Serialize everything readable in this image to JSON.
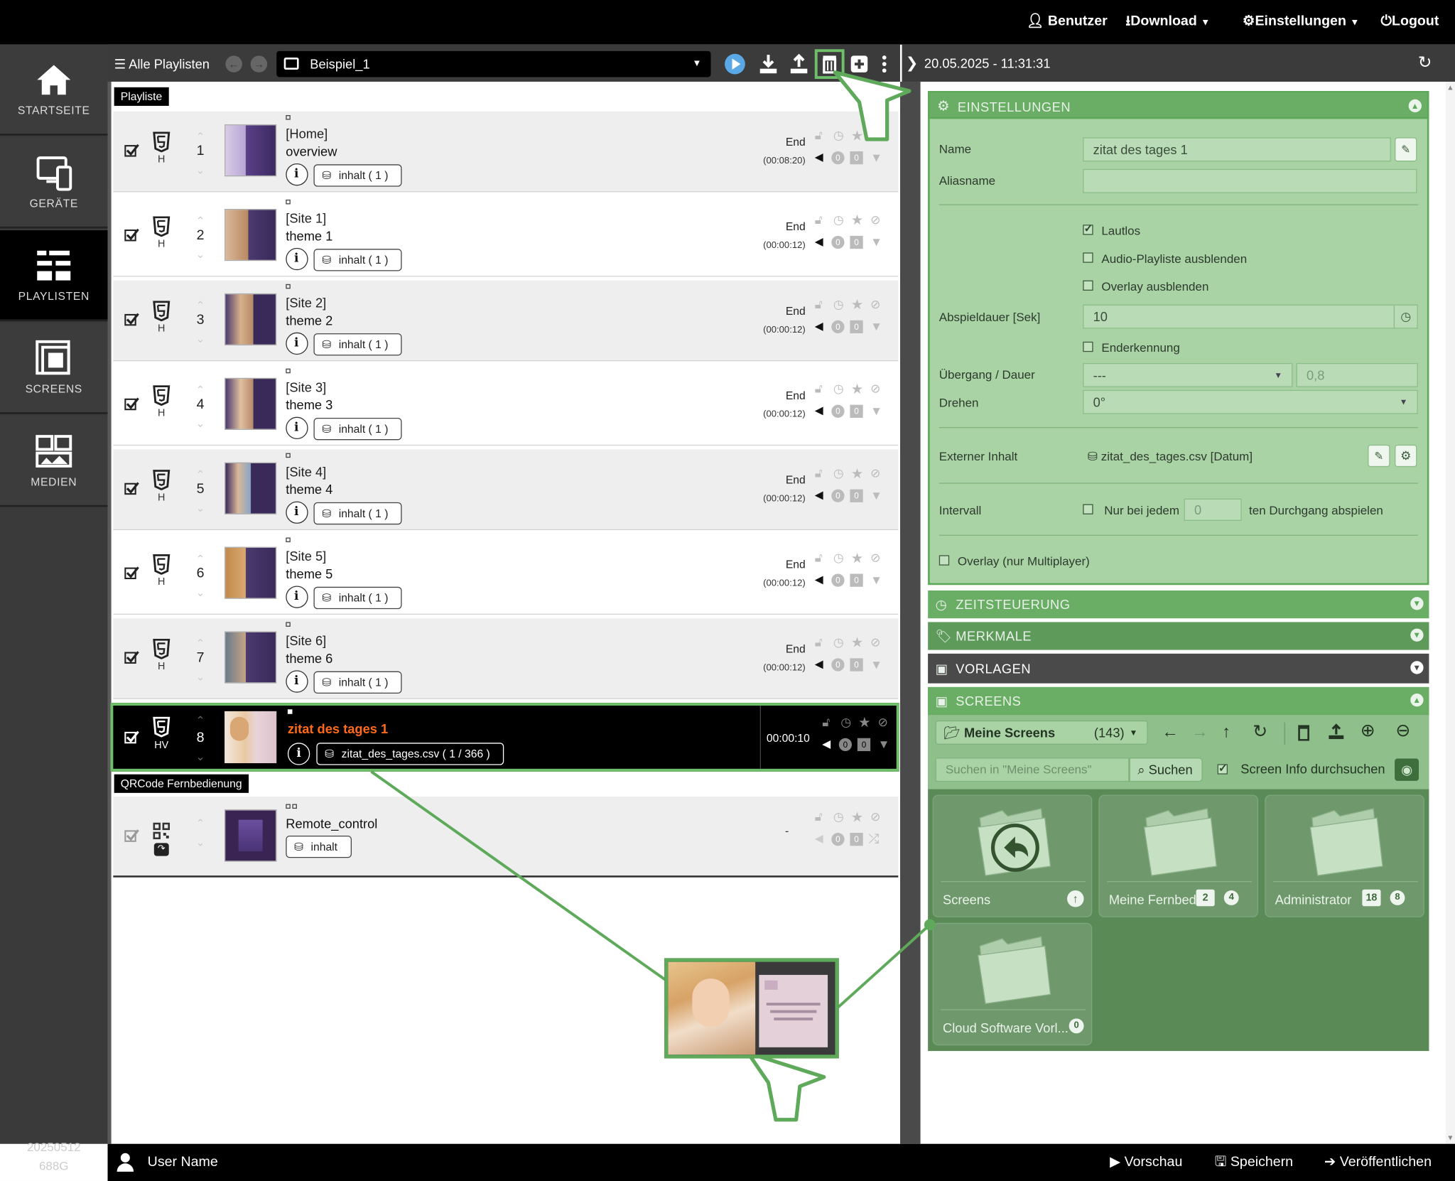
{
  "topbar": {
    "benutzer": "Benutzer",
    "download": "Download",
    "einstellungen": "Einstellungen",
    "logout": "Logout"
  },
  "sidebar": {
    "items": [
      {
        "label": "STARTSEITE",
        "icon": "home-icon"
      },
      {
        "label": "GERÄTE",
        "icon": "devices-icon"
      },
      {
        "label": "PLAYLISTEN",
        "icon": "playlist-icon"
      },
      {
        "label": "SCREENS",
        "icon": "screens-icon"
      },
      {
        "label": "MEDIEN",
        "icon": "media-icon"
      }
    ],
    "version_line1": "20250512",
    "version_line2": "688G"
  },
  "playlist_header": {
    "all_playlists": "Alle Playlisten",
    "selected": "Beispiel_1",
    "datetime": "20.05.2025 - 11:31:31"
  },
  "badges": {
    "playlist": "Playliste",
    "qrcode": "QRCode Fernbedienung"
  },
  "rows": [
    {
      "num": "1",
      "h": "H",
      "t1": "[Home]",
      "t2": "overview",
      "inhalt": "inhalt ( 1 )",
      "end": "End",
      "time": "(00:08:20)"
    },
    {
      "num": "2",
      "h": "H",
      "t1": "[Site 1]",
      "t2": "theme 1",
      "inhalt": "inhalt ( 1 )",
      "end": "End",
      "time": "(00:00:12)"
    },
    {
      "num": "3",
      "h": "H",
      "t1": "[Site 2]",
      "t2": "theme 2",
      "inhalt": "inhalt ( 1 )",
      "end": "End",
      "time": "(00:00:12)"
    },
    {
      "num": "4",
      "h": "H",
      "t1": "[Site 3]",
      "t2": "theme 3",
      "inhalt": "inhalt ( 1 )",
      "end": "End",
      "time": "(00:00:12)"
    },
    {
      "num": "5",
      "h": "H",
      "t1": "[Site 4]",
      "t2": "theme 4",
      "inhalt": "inhalt ( 1 )",
      "end": "End",
      "time": "(00:00:12)"
    },
    {
      "num": "6",
      "h": "H",
      "t1": "[Site 5]",
      "t2": "theme 5",
      "inhalt": "inhalt ( 1 )",
      "end": "End",
      "time": "(00:00:12)"
    },
    {
      "num": "7",
      "h": "H",
      "t1": "[Site 6]",
      "t2": "theme 6",
      "inhalt": "inhalt ( 1 )",
      "end": "End",
      "time": "(00:00:12)"
    }
  ],
  "selected_row": {
    "num": "8",
    "h": "HV",
    "title": "zitat des tages 1",
    "file": "zitat_des_tages.csv ( 1 / 366 )",
    "time": "00:00:10"
  },
  "remote_row": {
    "title": "Remote_control",
    "inhalt": "inhalt",
    "dash": "-"
  },
  "settings": {
    "header": "EINSTELLUNGEN",
    "name_label": "Name",
    "name_value": "zitat des tages 1",
    "alias_label": "Aliasname",
    "alias_value": "",
    "lautlos": "Lautlos",
    "audio": "Audio-Playliste ausblenden",
    "overlay": "Overlay ausblenden",
    "dauer_label": "Abspieldauer [Sek]",
    "dauer_value": "10",
    "enderkennung": "Enderkennung",
    "uebergang_label": "Übergang / Dauer",
    "uebergang_value": "---",
    "uebergang_dauer": "0,8",
    "drehen_label": "Drehen",
    "drehen_value": "0°",
    "extern_label": "Externer Inhalt",
    "extern_value": "zitat_des_tages.csv [Datum]",
    "intervall_label": "Intervall",
    "intervall_pre": "Nur bei jedem",
    "intervall_value": "0",
    "intervall_post": "ten Durchgang abspielen",
    "overlay_multi": "Overlay (nur Multiplayer)"
  },
  "sections": {
    "zeit": "ZEITSTEUERUNG",
    "merkmale": "MERKMALE",
    "vorlagen": "VORLAGEN",
    "screens": "SCREENS"
  },
  "screens": {
    "folder": "Meine Screens",
    "count": "(143)",
    "search_placeholder": "Suchen in \"Meine Screens\"",
    "search_btn": "Suchen",
    "info": "Screen Info durchsuchen",
    "cards": [
      {
        "label": "Screens"
      },
      {
        "label": "Meine Fernbedi...",
        "b1": "2",
        "b2": "4"
      },
      {
        "label": "Administrator",
        "b1": "18",
        "b2": "8"
      },
      {
        "label": "Cloud Software Vorl...",
        "b2": "0"
      }
    ]
  },
  "bottombar": {
    "user": "User Name",
    "vorschau": "Vorschau",
    "speichern": "Speichern",
    "veroeffentlichen": "Veröffentlichen"
  },
  "colors": {
    "accent_green": "#5ea95a",
    "panel_green": "#a9d3a5",
    "selected_orange": "#ff6a1a",
    "play_blue": "#5aa9e6"
  }
}
